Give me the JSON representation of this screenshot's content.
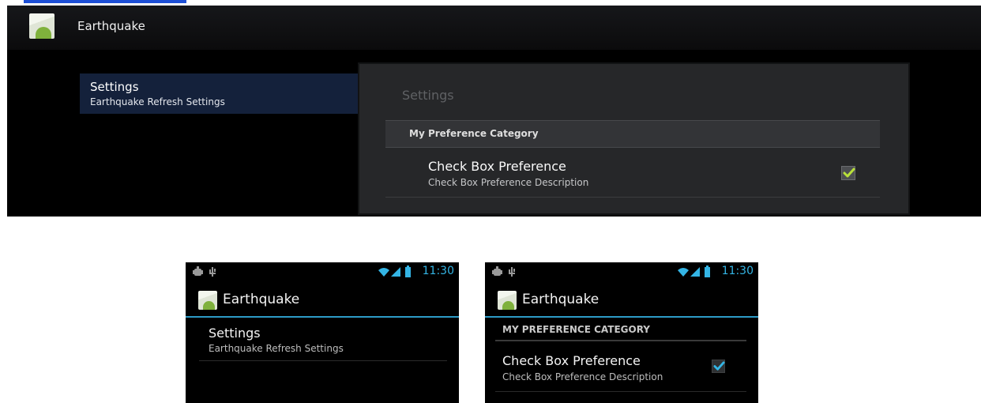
{
  "tablet": {
    "app_title": "Earthquake",
    "header": {
      "title": "Settings",
      "summary": "Earthquake Refresh Settings"
    },
    "pane": {
      "title": "Settings",
      "category": "My Preference Category",
      "pref_title": "Check Box Preference",
      "pref_summary": "Check Box Preference Description",
      "checked": true
    }
  },
  "phone_left": {
    "time": "11:30",
    "app_title": "Earthquake",
    "item_title": "Settings",
    "item_summary": "Earthquake Refresh Settings"
  },
  "phone_right": {
    "time": "11:30",
    "app_title": "Earthquake",
    "category": "MY PREFERENCE CATEGORY",
    "pref_title": "Check Box Preference",
    "pref_summary": "Check Box Preference Description",
    "checked": true
  },
  "colors": {
    "holo_blue": "#34b5e5",
    "tablet_check": "#b8e03a",
    "phone_check": "#33b5e5"
  },
  "icons": {
    "app": "earthquake-app-icon",
    "status_left": [
      "debug-icon",
      "usb-icon"
    ],
    "status_right": [
      "wifi-icon",
      "signal-icon",
      "battery-icon"
    ]
  }
}
